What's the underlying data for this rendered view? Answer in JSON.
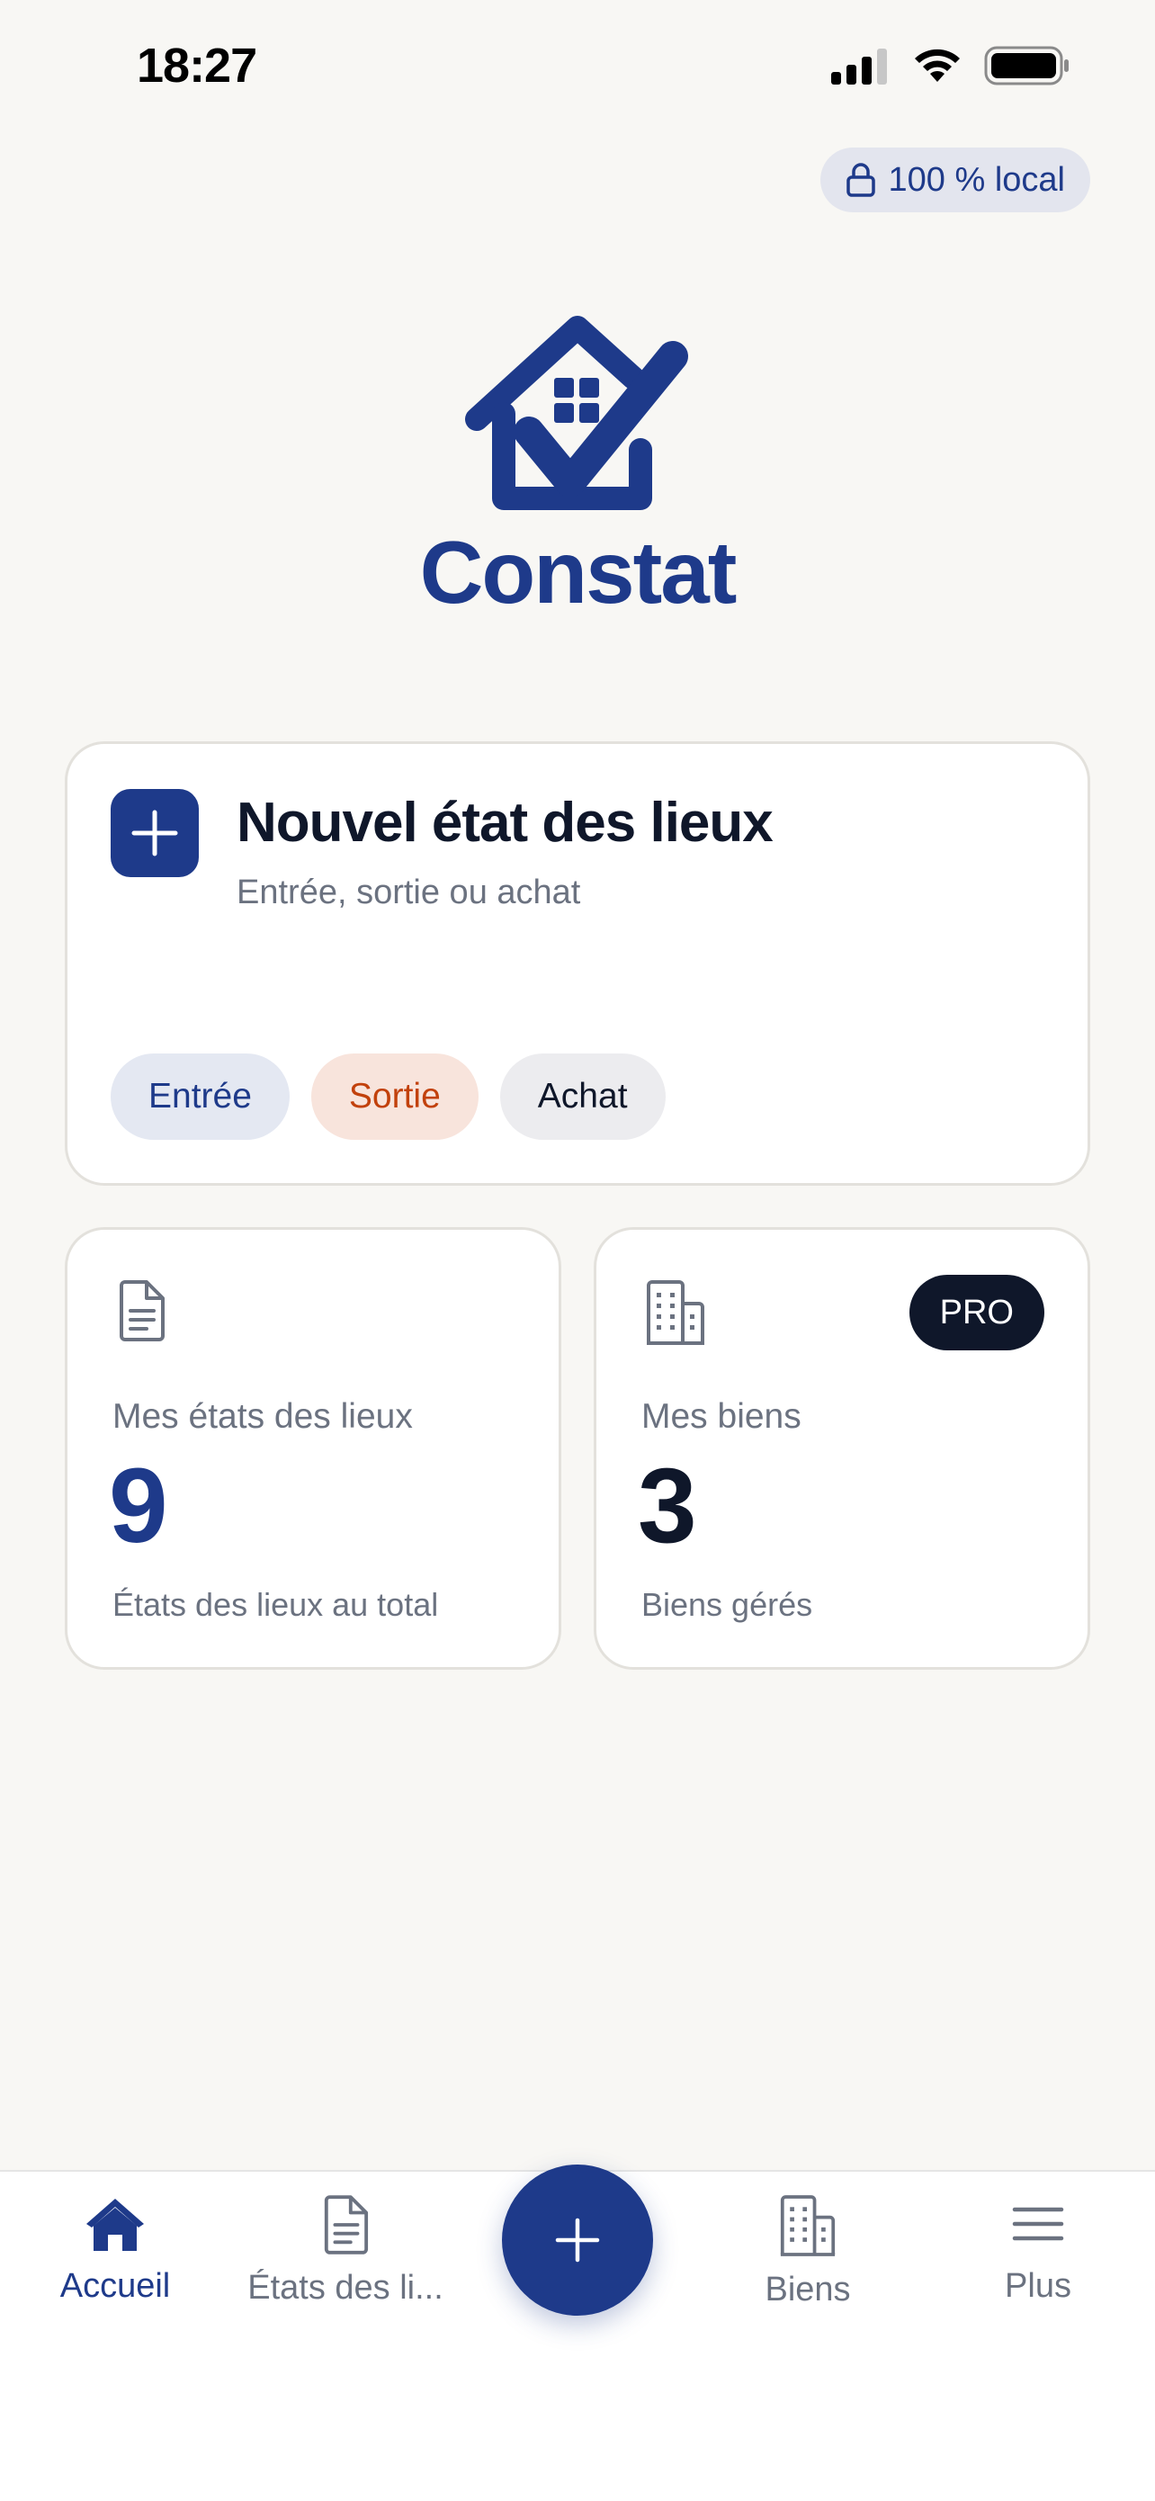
{
  "status_bar": {
    "time": "18:27",
    "icons": [
      "cellular-signal-icon",
      "wifi-icon",
      "battery-icon"
    ]
  },
  "privacy_badge": {
    "icon": "lock-icon",
    "label": "100 % local"
  },
  "brand": {
    "logo_icon": "house-check-icon",
    "name": "Constat"
  },
  "new_inspection": {
    "icon": "plus-icon",
    "title": "Nouvel état des lieux",
    "subtitle": "Entrée, sortie ou achat",
    "options": [
      {
        "label": "Entrée",
        "color": "#1e3a8a",
        "background": "#e4e8f2"
      },
      {
        "label": "Sortie",
        "color": "#c2410c",
        "background": "#f8e4dc"
      },
      {
        "label": "Achat",
        "color": "#0f172a",
        "background": "#ececef"
      }
    ]
  },
  "stats": {
    "inspections": {
      "icon": "document-icon",
      "label": "Mes états des lieux",
      "value": "9",
      "caption": "États des lieux au total"
    },
    "properties": {
      "icon": "building-icon",
      "badge": "PRO",
      "label": "Mes biens",
      "value": "3",
      "caption": "Biens gérés"
    }
  },
  "bottom_nav": {
    "items": [
      {
        "label": "Accueil",
        "icon": "home-icon",
        "active": true
      },
      {
        "label": "États des li...",
        "icon": "document-icon",
        "active": false
      },
      {
        "label": "Biens",
        "icon": "building-icon",
        "active": false
      },
      {
        "label": "Plus",
        "icon": "menu-icon",
        "active": false
      }
    ],
    "fab_icon": "plus-icon"
  },
  "colors": {
    "primary": "#1e3a8a",
    "background": "#f8f7f4",
    "text_dark": "#0f172a",
    "text_muted": "#6b7280"
  }
}
